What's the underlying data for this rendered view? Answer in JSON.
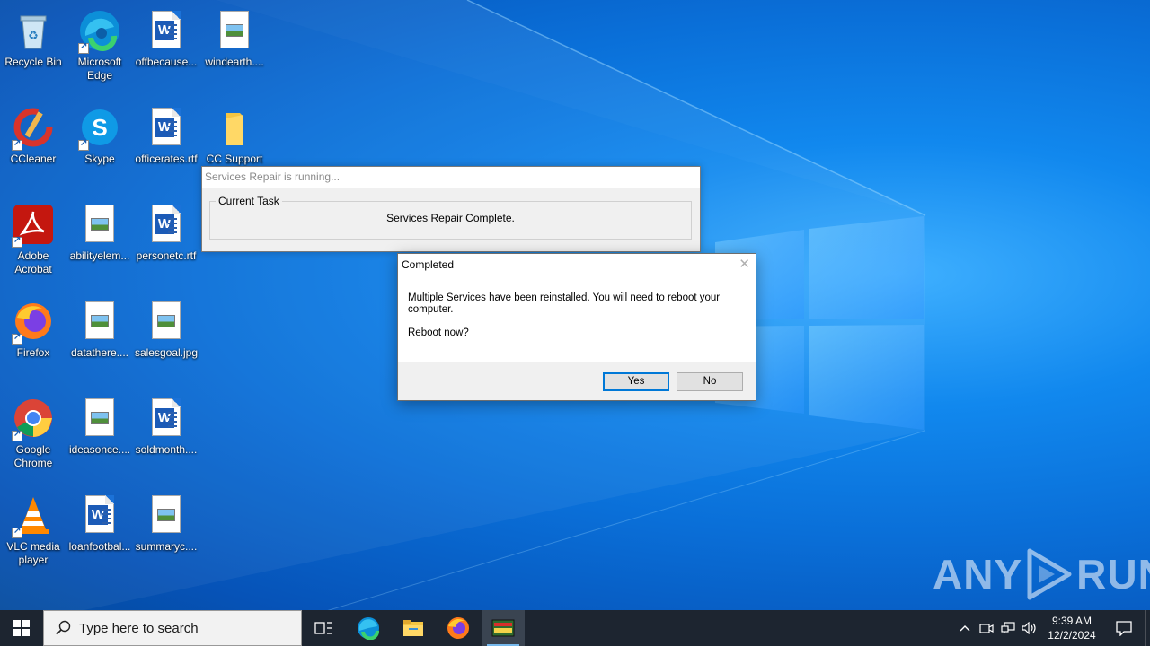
{
  "desktop": {
    "icons": [
      {
        "label": "Recycle Bin",
        "icon": "recycle-bin-icon"
      },
      {
        "label": "Microsoft Edge",
        "icon": "edge-icon"
      },
      {
        "label": "offbecause...",
        "icon": "word-doc-icon"
      },
      {
        "label": "windearth....",
        "icon": "image-file-icon"
      },
      {
        "label": "CCleaner",
        "icon": "ccleaner-icon"
      },
      {
        "label": "Skype",
        "icon": "skype-icon"
      },
      {
        "label": "officerates.rtf",
        "icon": "word-doc-icon"
      },
      {
        "label": "CC Support",
        "icon": "folder-icon"
      },
      {
        "label": "Adobe Acrobat",
        "icon": "acrobat-icon"
      },
      {
        "label": "abilityelem...",
        "icon": "image-file-icon"
      },
      {
        "label": "personetc.rtf",
        "icon": "word-doc-icon"
      },
      {
        "label": "Firefox",
        "icon": "firefox-icon"
      },
      {
        "label": "datathere....",
        "icon": "image-file-icon"
      },
      {
        "label": "salesgoal.jpg",
        "icon": "image-file-icon"
      },
      {
        "label": "Google Chrome",
        "icon": "chrome-icon"
      },
      {
        "label": "ideasonce....",
        "icon": "image-file-icon"
      },
      {
        "label": "soldmonth....",
        "icon": "word-doc-icon"
      },
      {
        "label": "VLC media player",
        "icon": "vlc-icon"
      },
      {
        "label": "loanfootbal...",
        "icon": "word-doc-icon"
      },
      {
        "label": "summaryc....",
        "icon": "image-file-icon"
      }
    ]
  },
  "repair_window": {
    "title": "Services Repair is running...",
    "group_label": "Current Task",
    "task_text": "Services Repair Complete."
  },
  "dialog": {
    "title": "Completed",
    "message": "Multiple Services have been reinstalled.  You will need to reboot your computer.",
    "question": "Reboot now?",
    "yes_label": "Yes",
    "no_label": "No"
  },
  "watermark": {
    "left": "ANY",
    "right": "RUN"
  },
  "taskbar": {
    "search_placeholder": "Type here to search",
    "pinned": [
      "task-view-icon",
      "edge-icon",
      "file-explorer-icon",
      "firefox-icon",
      "services-repair-icon"
    ],
    "clock_time": "9:39 AM",
    "clock_date": "12/2/2024"
  },
  "colors": {
    "accent": "#0078d7",
    "taskbar": "#1d2530",
    "wallpaper": "#0a6fd8"
  }
}
